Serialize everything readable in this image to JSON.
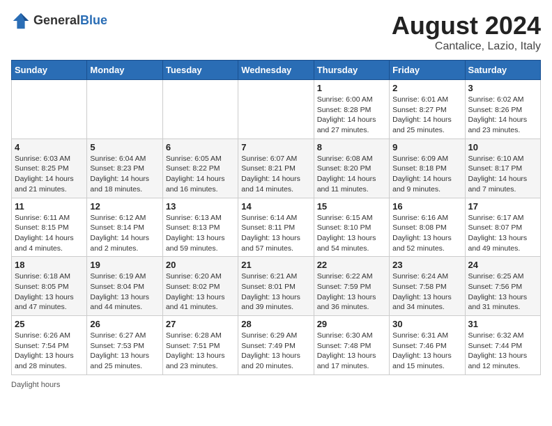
{
  "header": {
    "logo_general": "General",
    "logo_blue": "Blue",
    "title": "August 2024",
    "subtitle": "Cantalice, Lazio, Italy"
  },
  "days_of_week": [
    "Sunday",
    "Monday",
    "Tuesday",
    "Wednesday",
    "Thursday",
    "Friday",
    "Saturday"
  ],
  "weeks": [
    [
      {
        "day": "",
        "info": ""
      },
      {
        "day": "",
        "info": ""
      },
      {
        "day": "",
        "info": ""
      },
      {
        "day": "",
        "info": ""
      },
      {
        "day": "1",
        "info": "Sunrise: 6:00 AM\nSunset: 8:28 PM\nDaylight: 14 hours and 27 minutes."
      },
      {
        "day": "2",
        "info": "Sunrise: 6:01 AM\nSunset: 8:27 PM\nDaylight: 14 hours and 25 minutes."
      },
      {
        "day": "3",
        "info": "Sunrise: 6:02 AM\nSunset: 8:26 PM\nDaylight: 14 hours and 23 minutes."
      }
    ],
    [
      {
        "day": "4",
        "info": "Sunrise: 6:03 AM\nSunset: 8:25 PM\nDaylight: 14 hours and 21 minutes."
      },
      {
        "day": "5",
        "info": "Sunrise: 6:04 AM\nSunset: 8:23 PM\nDaylight: 14 hours and 18 minutes."
      },
      {
        "day": "6",
        "info": "Sunrise: 6:05 AM\nSunset: 8:22 PM\nDaylight: 14 hours and 16 minutes."
      },
      {
        "day": "7",
        "info": "Sunrise: 6:07 AM\nSunset: 8:21 PM\nDaylight: 14 hours and 14 minutes."
      },
      {
        "day": "8",
        "info": "Sunrise: 6:08 AM\nSunset: 8:20 PM\nDaylight: 14 hours and 11 minutes."
      },
      {
        "day": "9",
        "info": "Sunrise: 6:09 AM\nSunset: 8:18 PM\nDaylight: 14 hours and 9 minutes."
      },
      {
        "day": "10",
        "info": "Sunrise: 6:10 AM\nSunset: 8:17 PM\nDaylight: 14 hours and 7 minutes."
      }
    ],
    [
      {
        "day": "11",
        "info": "Sunrise: 6:11 AM\nSunset: 8:15 PM\nDaylight: 14 hours and 4 minutes."
      },
      {
        "day": "12",
        "info": "Sunrise: 6:12 AM\nSunset: 8:14 PM\nDaylight: 14 hours and 2 minutes."
      },
      {
        "day": "13",
        "info": "Sunrise: 6:13 AM\nSunset: 8:13 PM\nDaylight: 13 hours and 59 minutes."
      },
      {
        "day": "14",
        "info": "Sunrise: 6:14 AM\nSunset: 8:11 PM\nDaylight: 13 hours and 57 minutes."
      },
      {
        "day": "15",
        "info": "Sunrise: 6:15 AM\nSunset: 8:10 PM\nDaylight: 13 hours and 54 minutes."
      },
      {
        "day": "16",
        "info": "Sunrise: 6:16 AM\nSunset: 8:08 PM\nDaylight: 13 hours and 52 minutes."
      },
      {
        "day": "17",
        "info": "Sunrise: 6:17 AM\nSunset: 8:07 PM\nDaylight: 13 hours and 49 minutes."
      }
    ],
    [
      {
        "day": "18",
        "info": "Sunrise: 6:18 AM\nSunset: 8:05 PM\nDaylight: 13 hours and 47 minutes."
      },
      {
        "day": "19",
        "info": "Sunrise: 6:19 AM\nSunset: 8:04 PM\nDaylight: 13 hours and 44 minutes."
      },
      {
        "day": "20",
        "info": "Sunrise: 6:20 AM\nSunset: 8:02 PM\nDaylight: 13 hours and 41 minutes."
      },
      {
        "day": "21",
        "info": "Sunrise: 6:21 AM\nSunset: 8:01 PM\nDaylight: 13 hours and 39 minutes."
      },
      {
        "day": "22",
        "info": "Sunrise: 6:22 AM\nSunset: 7:59 PM\nDaylight: 13 hours and 36 minutes."
      },
      {
        "day": "23",
        "info": "Sunrise: 6:24 AM\nSunset: 7:58 PM\nDaylight: 13 hours and 34 minutes."
      },
      {
        "day": "24",
        "info": "Sunrise: 6:25 AM\nSunset: 7:56 PM\nDaylight: 13 hours and 31 minutes."
      }
    ],
    [
      {
        "day": "25",
        "info": "Sunrise: 6:26 AM\nSunset: 7:54 PM\nDaylight: 13 hours and 28 minutes."
      },
      {
        "day": "26",
        "info": "Sunrise: 6:27 AM\nSunset: 7:53 PM\nDaylight: 13 hours and 25 minutes."
      },
      {
        "day": "27",
        "info": "Sunrise: 6:28 AM\nSunset: 7:51 PM\nDaylight: 13 hours and 23 minutes."
      },
      {
        "day": "28",
        "info": "Sunrise: 6:29 AM\nSunset: 7:49 PM\nDaylight: 13 hours and 20 minutes."
      },
      {
        "day": "29",
        "info": "Sunrise: 6:30 AM\nSunset: 7:48 PM\nDaylight: 13 hours and 17 minutes."
      },
      {
        "day": "30",
        "info": "Sunrise: 6:31 AM\nSunset: 7:46 PM\nDaylight: 13 hours and 15 minutes."
      },
      {
        "day": "31",
        "info": "Sunrise: 6:32 AM\nSunset: 7:44 PM\nDaylight: 13 hours and 12 minutes."
      }
    ]
  ],
  "footer": {
    "daylight_label": "Daylight hours"
  }
}
